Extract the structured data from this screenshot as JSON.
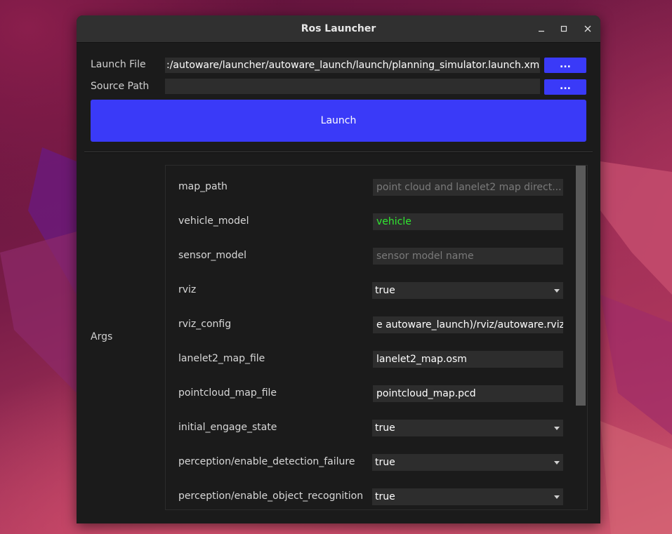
{
  "window": {
    "title": "Ros Launcher"
  },
  "titlebar_buttons": [
    {
      "name": "minimize-button",
      "icon": "minimize-icon"
    },
    {
      "name": "maximize-button",
      "icon": "maximize-icon"
    },
    {
      "name": "close-button",
      "icon": "close-icon"
    }
  ],
  "launch_file": {
    "label": "Launch File",
    "value": ":/autoware/launcher/autoware_launch/launch/planning_simulator.launch.xml",
    "browse_label": "..."
  },
  "source_path": {
    "label": "Source Path",
    "value": "",
    "browse_label": "..."
  },
  "launch_button": {
    "label": "Launch"
  },
  "args": {
    "label": "Args",
    "rows": [
      {
        "name": "map_path",
        "type": "text",
        "value": "",
        "placeholder": "point cloud and lanelet2 map direct..."
      },
      {
        "name": "vehicle_model",
        "type": "text",
        "value": "vehicle",
        "placeholder": "",
        "value_color": "#30e830"
      },
      {
        "name": "sensor_model",
        "type": "text",
        "value": "",
        "placeholder": "sensor model name"
      },
      {
        "name": "rviz",
        "type": "combo",
        "value": "true"
      },
      {
        "name": "rviz_config",
        "type": "text",
        "value": "e autoware_launch)/rviz/autoware.rviz",
        "placeholder": ""
      },
      {
        "name": "lanelet2_map_file",
        "type": "text",
        "value": "lanelet2_map.osm",
        "placeholder": ""
      },
      {
        "name": "pointcloud_map_file",
        "type": "text",
        "value": "pointcloud_map.pcd",
        "placeholder": ""
      },
      {
        "name": "initial_engage_state",
        "type": "combo",
        "value": "true"
      },
      {
        "name": "perception/enable_detection_failure",
        "type": "combo",
        "value": "true"
      },
      {
        "name": "perception/enable_object_recognition",
        "type": "combo",
        "value": "true"
      }
    ]
  },
  "colors": {
    "accent_button": "#3a3af8",
    "window_bg": "#1b1b1b",
    "titlebar_bg": "#303030",
    "field_bg": "#2d2d2d",
    "highlight_text": "#30e830"
  }
}
